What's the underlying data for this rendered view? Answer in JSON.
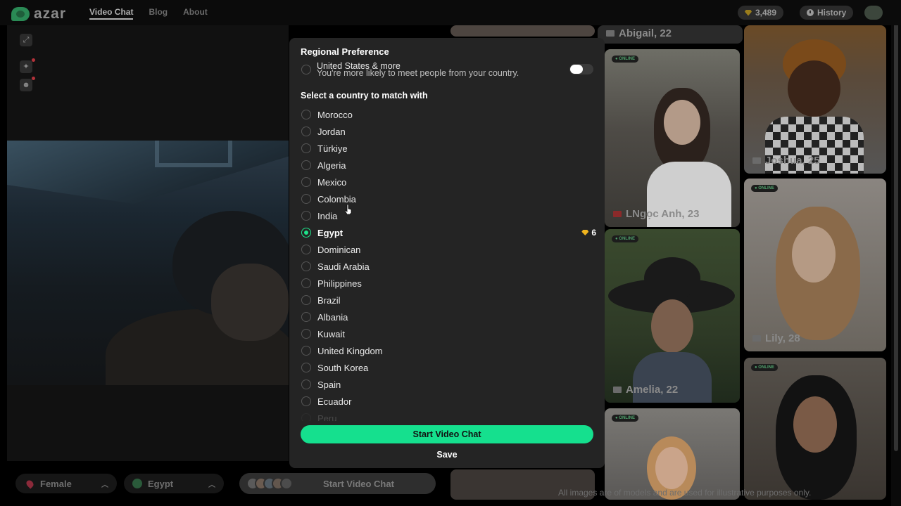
{
  "header": {
    "logo_text": "azar",
    "nav": [
      "Video Chat",
      "Blog",
      "About"
    ],
    "gems": "3,489",
    "history_label": "History"
  },
  "controls": {
    "gender_label": "Female",
    "country_label": "Egypt",
    "start_label": "Start Video Chat"
  },
  "gallery": {
    "cards": [
      {
        "name": "Abigail, 22",
        "online": ""
      },
      {
        "name": "Joshua, 25",
        "online": ""
      },
      {
        "name": "LNgọc Anh, 23",
        "online": "● ONLINE"
      },
      {
        "name": "Lily, 28",
        "online": "● ONLINE"
      },
      {
        "name": "Amelia, 22",
        "online": "● ONLINE"
      },
      {
        "name": "",
        "online": "● ONLINE"
      },
      {
        "name": "",
        "online": "● ONLINE"
      }
    ],
    "disclaimer": "All images are of models and are used for illustrative purposes only."
  },
  "modal": {
    "title": "Regional Preference",
    "region_option": "United States & more",
    "region_description": "You're more likely to meet people from your country.",
    "subtitle": "Select a country to match with",
    "countries": [
      "Morocco",
      "Jordan",
      "Türkiye",
      "Algeria",
      "Mexico",
      "Colombia",
      "India",
      "Egypt",
      "Dominican",
      "Saudi Arabia",
      "Philippines",
      "Brazil",
      "Albania",
      "Kuwait",
      "United Kingdom",
      "South Korea",
      "Spain",
      "Ecuador",
      "Peru"
    ],
    "selected_country": "Egypt",
    "selected_price": "6",
    "start_button": "Start Video Chat",
    "save_button": "Save"
  },
  "colors": {
    "accent": "#15e08e",
    "modal_bg": "#242424",
    "gem": "#f0b41e"
  }
}
